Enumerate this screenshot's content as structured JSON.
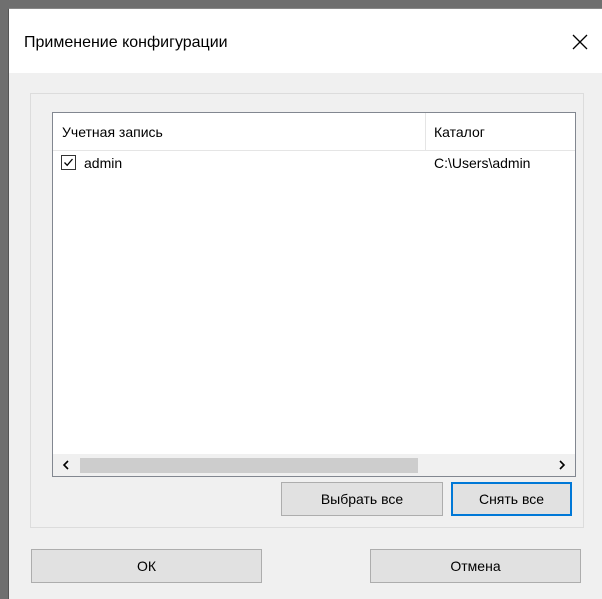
{
  "dialog": {
    "title": "Применение конфигурации"
  },
  "list": {
    "columns": [
      "Учетная запись",
      "Каталог"
    ],
    "rows": [
      {
        "checked": true,
        "account": "admin",
        "catalog": "C:\\Users\\admin"
      }
    ]
  },
  "buttons": {
    "select_all": "Выбрать все",
    "deselect_all": "Снять все",
    "ok": "ОК",
    "cancel": "Отмена"
  },
  "colors": {
    "focus_accent": "#0078d7",
    "button_face": "#e1e1e1"
  }
}
